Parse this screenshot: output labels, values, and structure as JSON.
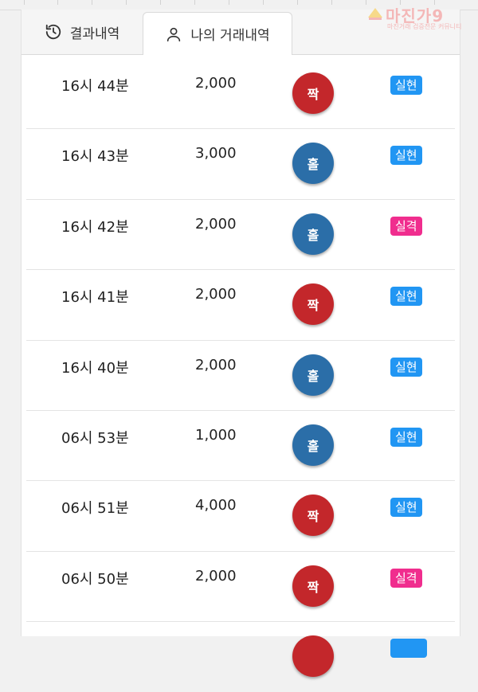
{
  "tabs": [
    {
      "label": "결과내역",
      "icon": "history-icon"
    },
    {
      "label": "나의 거래내역",
      "icon": "user-icon"
    }
  ],
  "logo": {
    "text": "마진가9",
    "sub": "마진거래 검증전문 커뮤니티"
  },
  "colors": {
    "even": "#c3272b",
    "odd": "#2b6ea8",
    "win": "#2196f3",
    "loss": "#f02d8e"
  },
  "rows": [
    {
      "time": "16시 44분",
      "amount": "2,000",
      "pick": "짝",
      "result": "실현"
    },
    {
      "time": "16시 43분",
      "amount": "3,000",
      "pick": "홀",
      "result": "실현"
    },
    {
      "time": "16시 42분",
      "amount": "2,000",
      "pick": "홀",
      "result": "실격"
    },
    {
      "time": "16시 41분",
      "amount": "2,000",
      "pick": "짝",
      "result": "실현"
    },
    {
      "time": "16시 40분",
      "amount": "2,000",
      "pick": "홀",
      "result": "실현"
    },
    {
      "time": "06시 53분",
      "amount": "1,000",
      "pick": "홀",
      "result": "실현"
    },
    {
      "time": "06시 51분",
      "amount": "4,000",
      "pick": "짝",
      "result": "실현"
    },
    {
      "time": "06시 50분",
      "amount": "2,000",
      "pick": "짝",
      "result": "실격"
    }
  ]
}
